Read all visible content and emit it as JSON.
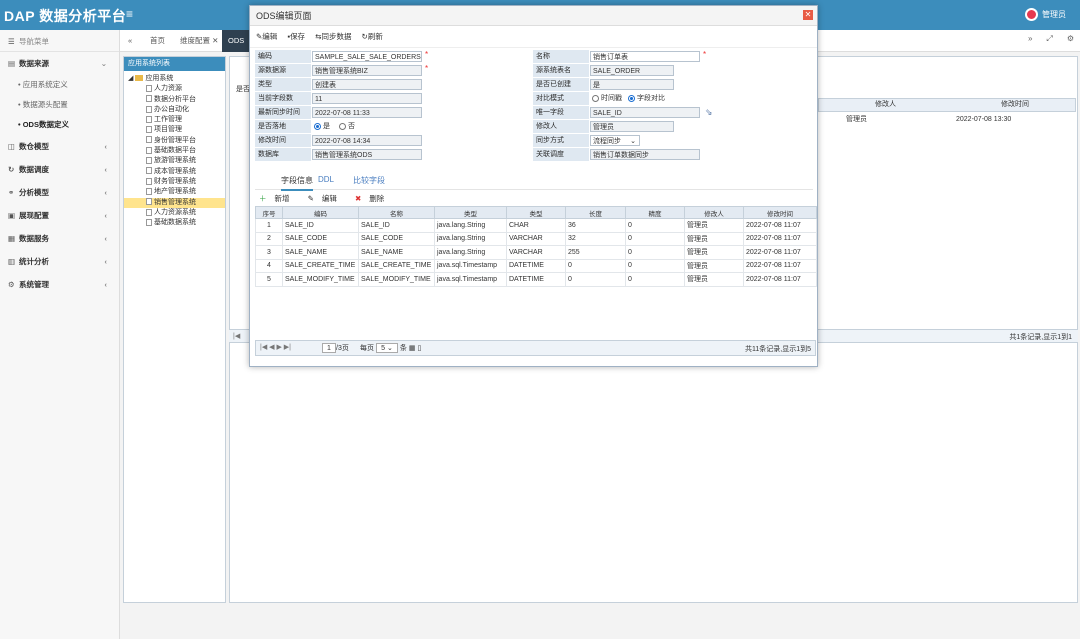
{
  "app": {
    "title": "DAP 数据分析平台",
    "user": "管理员"
  },
  "sidebar": {
    "header": "导航菜单",
    "groups": [
      {
        "label": "数据来源",
        "subs": [
          "应用系统定义",
          "数据源头配置",
          "ODS数据定义"
        ]
      },
      {
        "label": "数仓模型"
      },
      {
        "label": "数据调度"
      },
      {
        "label": "分析模型"
      },
      {
        "label": "展现配置"
      },
      {
        "label": "数据服务"
      },
      {
        "label": "统计分析"
      },
      {
        "label": "系统管理"
      }
    ]
  },
  "tabs": {
    "home": "首页",
    "dim": "维度配置",
    "ods": "ODS"
  },
  "tree": {
    "title": "应用系统列表",
    "root": "应用系统",
    "children": [
      "人力资源",
      "数据分析平台",
      "办公自动化",
      "工作管理",
      "项目管理",
      "身份管理平台",
      "基础数据平台",
      "旅游管理系统",
      "成本管理系统",
      "财务管理系统",
      "地产管理系统",
      "销售管理系统",
      "人力资源系统",
      "基础数据系统"
    ]
  },
  "background": {
    "col_modifier": "修改人",
    "col_modtime": "修改时间",
    "row_modifier": "管理员",
    "row_modtime": "2022-07-08 13:30",
    "pager_text": "共1条记录,显示1到1",
    "left_label": "是否"
  },
  "modal": {
    "title": "ODS编辑页面",
    "toolbar": {
      "edit": "编辑",
      "save": "保存",
      "sync": "同步数据",
      "refresh": "刷新"
    },
    "fields": {
      "code_label": "编码",
      "code": "SAMPLE_SALE_SALE_ORDERS",
      "name_label": "名称",
      "name": "销售订单表",
      "source_label": "源数据源",
      "source": "销售管理系统BIZ",
      "src_table_label": "源系统表名",
      "src_table": "SALE_ORDER",
      "type_label": "类型",
      "type": "创建表",
      "created_label": "是否已创建",
      "created": "是",
      "count_label": "当前字段数",
      "count": "11",
      "compare_label": "对比模式",
      "compare_time": "时间戳",
      "compare_field": "字段对比",
      "lastsync_label": "最新同步时间",
      "lastsync": "2022-07-08 11:33",
      "uniq_label": "唯一字段",
      "uniq": "SALE_ID",
      "landed_label": "是否落地",
      "yes": "是",
      "no": "否",
      "modifier_label": "修改人",
      "modifier": "管理员",
      "modtime_label": "修改时间",
      "modtime": "2022-07-08 14:34",
      "syncmode_label": "同步方式",
      "syncmode": "流程同步",
      "db_label": "数据库",
      "db": "销售管理系统ODS",
      "job_label": "关联调度",
      "job": "销售订单数据同步"
    },
    "subtabs": [
      "字段信息",
      "DDL",
      "比较字段"
    ],
    "subtoolbar": {
      "add": "新增",
      "edit": "编辑",
      "del": "删除"
    },
    "grid": {
      "headers": [
        "序号",
        "编码",
        "名称",
        "类型",
        "类型",
        "长度",
        "精度",
        "修改人",
        "修改时间"
      ],
      "rows": [
        [
          "1",
          "SALE_ID",
          "SALE_ID",
          "java.lang.String",
          "CHAR",
          "36",
          "0",
          "管理员",
          "2022-07-08 11:07"
        ],
        [
          "2",
          "SALE_CODE",
          "SALE_CODE",
          "java.lang.String",
          "VARCHAR",
          "32",
          "0",
          "管理员",
          "2022-07-08 11:07"
        ],
        [
          "3",
          "SALE_NAME",
          "SALE_NAME",
          "java.lang.String",
          "VARCHAR",
          "255",
          "0",
          "管理员",
          "2022-07-08 11:07"
        ],
        [
          "4",
          "SALE_CREATE_TIME",
          "SALE_CREATE_TIME",
          "java.sql.Timestamp",
          "DATETIME",
          "0",
          "0",
          "管理员",
          "2022-07-08 11:07"
        ],
        [
          "5",
          "SALE_MODIFY_TIME",
          "SALE_MODIFY_TIME",
          "java.sql.Timestamp",
          "DATETIME",
          "0",
          "0",
          "管理员",
          "2022-07-08 11:07"
        ]
      ]
    },
    "pager": {
      "page": "1",
      "pages": "/3页",
      "per_label": "每页",
      "per": "5",
      "per_unit": "条",
      "summary": "共11条记录,显示1到5"
    }
  }
}
